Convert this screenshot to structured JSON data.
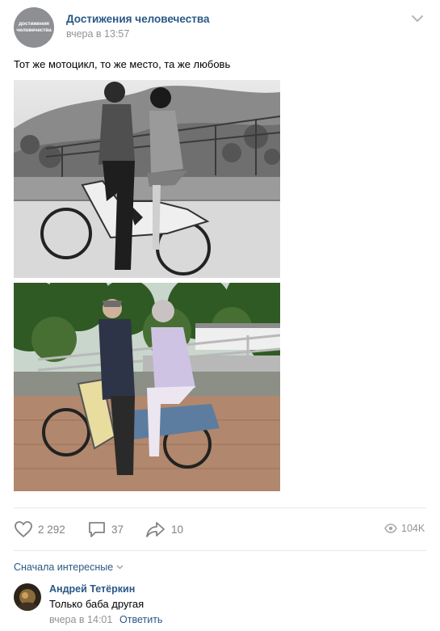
{
  "post": {
    "group_name": "Достижения человечества",
    "avatar_line1": "достижения",
    "avatar_line2": "человечества",
    "time": "вчера в 13:57",
    "text": "Тот же мотоцикл, то же место, та же любовь"
  },
  "actions": {
    "likes": "2 292",
    "comments": "37",
    "shares": "10",
    "views": "104K"
  },
  "comments": {
    "sort_label": "Сначала интересные",
    "items": [
      {
        "author": "Андрей Тетёркин",
        "text": "Только баба другая",
        "time": "вчера в 14:01",
        "reply_label": "Ответить"
      }
    ]
  },
  "colors": {
    "link": "#2a5885",
    "muted": "#939393",
    "icon": "#828282",
    "divider": "#e7e8ec"
  },
  "icons": [
    "chevron-down-icon",
    "heart-icon",
    "comment-icon",
    "share-icon",
    "eye-icon"
  ]
}
